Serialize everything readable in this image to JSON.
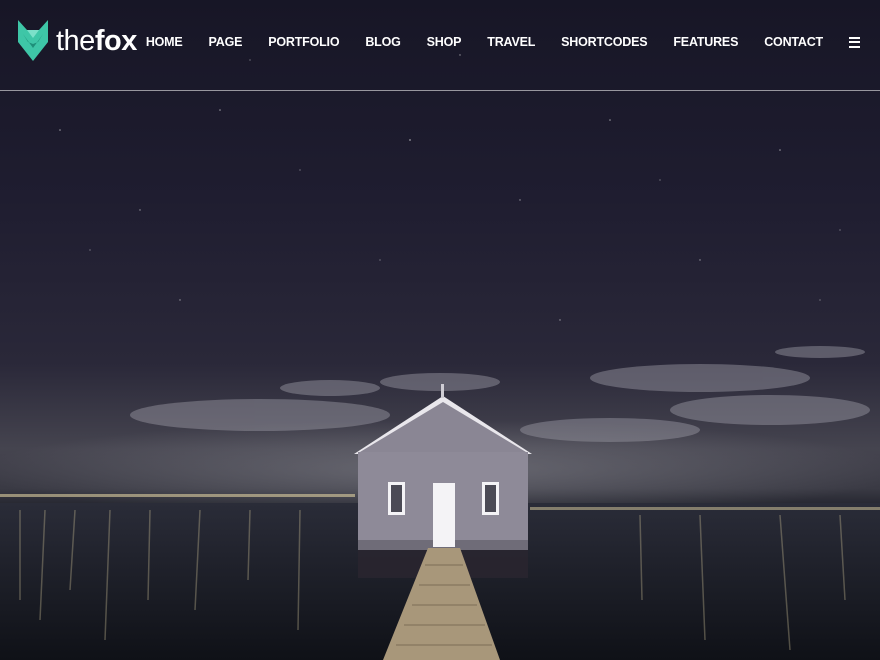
{
  "brand": {
    "name_light": "the",
    "name_bold": "fox",
    "logo_icon": "fox-head-icon",
    "accent_color": "#3ec6a7"
  },
  "nav": {
    "items": [
      {
        "label": "HOME"
      },
      {
        "label": "PAGE"
      },
      {
        "label": "PORTFOLIO"
      },
      {
        "label": "BLOG"
      },
      {
        "label": "SHOP"
      },
      {
        "label": "TRAVEL"
      },
      {
        "label": "SHORTCODES"
      },
      {
        "label": "FEATURES"
      },
      {
        "label": "CONTACT"
      }
    ],
    "menu_icon": "hamburger-menu-icon"
  },
  "hero": {
    "image_subject": "boathouse-on-pier-night-sky"
  }
}
